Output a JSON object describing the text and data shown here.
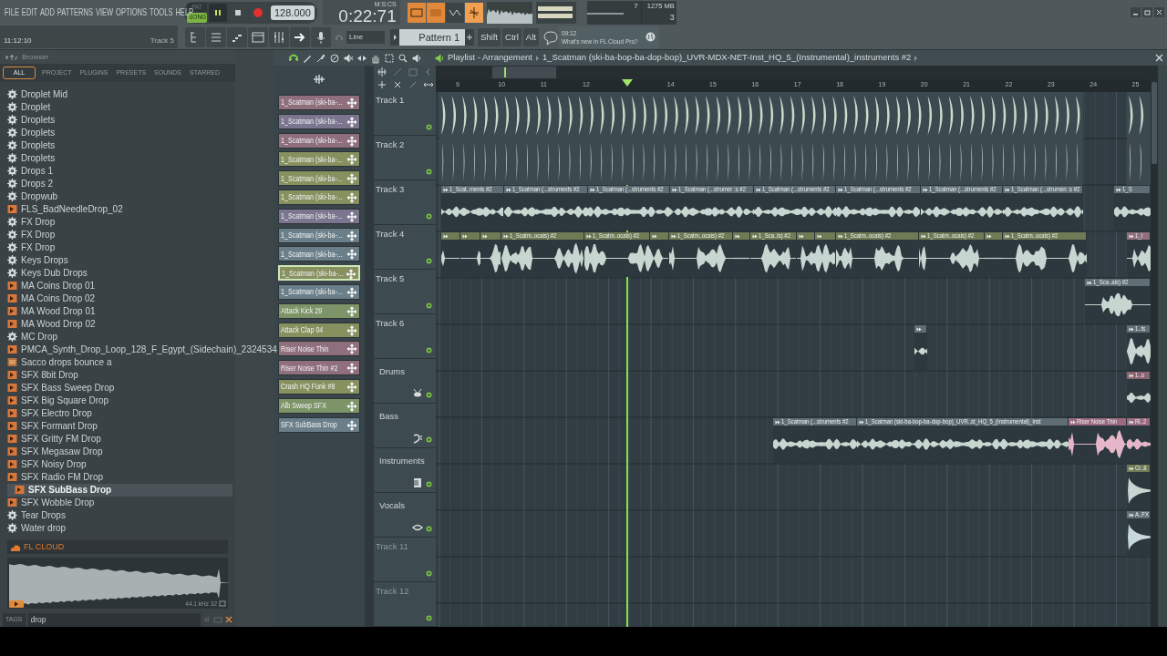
{
  "menu": [
    "FILE",
    "EDIT",
    "ADD",
    "PATTERNS",
    "VIEW",
    "OPTIONS",
    "TOOLS",
    "HELP"
  ],
  "transport": {
    "modes": [
      {
        "label": "PAT",
        "selected": false
      },
      {
        "label": "SONG",
        "selected": true
      }
    ],
    "tempo": "128.000",
    "time_unit": "M:S:CS",
    "time": "0:22:71"
  },
  "hint": {
    "time": "11:12:10",
    "text": "Track 5"
  },
  "snap": "Line",
  "pattern": "Pattern 1",
  "modifier_keys": [
    "Shift",
    "Ctrl",
    "Alt"
  ],
  "news": {
    "time": "09:12",
    "text": "What's new in FL Cloud Pro?"
  },
  "monitor": {
    "cpu": "7",
    "memory": "1275 MB",
    "polyphony": "3"
  },
  "browser": {
    "title": "Browser",
    "tabs": [
      {
        "label": "ALL",
        "selected": true
      },
      {
        "label": "PROJECT",
        "selected": false
      },
      {
        "label": "PLUGINS",
        "selected": false
      },
      {
        "label": "PRESETS",
        "selected": false
      },
      {
        "label": "SOUNDS",
        "selected": false
      },
      {
        "label": "STARRED",
        "selected": false
      }
    ],
    "items": [
      {
        "label": "Droplet Mid",
        "kind": "preset",
        "selected": false
      },
      {
        "label": "Droplet",
        "kind": "preset",
        "selected": false
      },
      {
        "label": "Droplets",
        "kind": "preset",
        "selected": false
      },
      {
        "label": "Droplets",
        "kind": "preset",
        "selected": false
      },
      {
        "label": "Droplets",
        "kind": "preset",
        "selected": false
      },
      {
        "label": "Droplets",
        "kind": "preset",
        "selected": false
      },
      {
        "label": "Drops 1",
        "kind": "preset",
        "selected": false
      },
      {
        "label": "Drops 2",
        "kind": "preset",
        "selected": false
      },
      {
        "label": "Dropwub",
        "kind": "preset",
        "selected": false
      },
      {
        "label": "FLS_BadNeedleDrop_02",
        "kind": "audio",
        "selected": false
      },
      {
        "label": "FX Drop",
        "kind": "preset",
        "selected": false
      },
      {
        "label": "FX Drop",
        "kind": "preset",
        "selected": false
      },
      {
        "label": "FX Drop",
        "kind": "preset",
        "selected": false
      },
      {
        "label": "Keys Drops",
        "kind": "preset",
        "selected": false
      },
      {
        "label": "Keys Dub Drops",
        "kind": "preset",
        "selected": false
      },
      {
        "label": "MA Coins Drop 01",
        "kind": "audio",
        "selected": false
      },
      {
        "label": "MA Coins Drop 02",
        "kind": "audio",
        "selected": false
      },
      {
        "label": "MA Wood Drop 01",
        "kind": "audio",
        "selected": false
      },
      {
        "label": "MA Wood Drop 02",
        "kind": "audio",
        "selected": false
      },
      {
        "label": "MC Drop",
        "kind": "preset",
        "selected": false
      },
      {
        "label": "PMCA_Synth_Drop_Loop_128_F_Egypt_(Sidechain)_2324534",
        "kind": "audio",
        "selected": false
      },
      {
        "label": "Sacco drops bounce a",
        "kind": "project",
        "selected": false
      },
      {
        "label": "SFX 8bit Drop",
        "kind": "audio",
        "selected": false
      },
      {
        "label": "SFX Bass Sweep Drop",
        "kind": "audio",
        "selected": false
      },
      {
        "label": "SFX Big Square Drop",
        "kind": "audio",
        "selected": false
      },
      {
        "label": "SFX Electro Drop",
        "kind": "audio",
        "selected": false
      },
      {
        "label": "SFX Formant Drop",
        "kind": "audio",
        "selected": false
      },
      {
        "label": "SFX Gritty FM Drop",
        "kind": "audio",
        "selected": false
      },
      {
        "label": "SFX Megasaw Drop",
        "kind": "audio",
        "selected": false
      },
      {
        "label": "SFX Noisy Drop",
        "kind": "audio",
        "selected": false
      },
      {
        "label": "SFX Radio FM Drop",
        "kind": "audio",
        "selected": false
      },
      {
        "label": "SFX SubBass Drop",
        "kind": "audio",
        "selected": true
      },
      {
        "label": "SFX Wobble Drop",
        "kind": "audio",
        "selected": false
      },
      {
        "label": "Tear Drops",
        "kind": "preset",
        "selected": false
      },
      {
        "label": "Water drop",
        "kind": "preset",
        "selected": false
      }
    ],
    "cloud": "FL CLOUD",
    "preview_info": "44.1 kHz 32",
    "tags_label": "TAGS",
    "search": "drop"
  },
  "playlist": {
    "title": "Playlist - Arrangement",
    "pattern_name": "1_Scatman (ski-ba-bop-ba-dop-bop)_UVR-MDX-NET-Inst_HQ_5_(Instrumental)_instruments #2",
    "ruler": [
      "9",
      "10",
      "11",
      "12",
      "14",
      "15",
      "16",
      "17",
      "18",
      "19",
      "20",
      "21",
      "22",
      "23",
      "24",
      "25"
    ],
    "picker": [
      {
        "label": "1_Scatman (ski-ba-...",
        "color": "#8f6f7c",
        "selected": false
      },
      {
        "label": "1_Scatman (ski-ba-...",
        "color": "#7b7590",
        "selected": false
      },
      {
        "label": "1_Scatman (ski-ba-...",
        "color": "#8f6f7c",
        "selected": false
      },
      {
        "label": "1_Scatman (ski-ba-...",
        "color": "#87905f",
        "selected": false
      },
      {
        "label": "1_Scatman (ski-ba-...",
        "color": "#87905f",
        "selected": false
      },
      {
        "label": "1_Scatman (ski-ba-...",
        "color": "#87905f",
        "selected": false
      },
      {
        "label": "1_Scatman (ski-ba-...",
        "color": "#7b7590",
        "selected": false
      },
      {
        "label": "1_Scatman (ski-ba-...",
        "color": "#6b7f8a",
        "selected": false
      },
      {
        "label": "1_Scatman (ski-ba-...",
        "color": "#6b7f8a",
        "selected": false
      },
      {
        "label": "1_Scatman (ski-ba-...",
        "color": "#87905f",
        "selected": true
      },
      {
        "label": "1_Scatman (ski-ba-...",
        "color": "#6b7f8a",
        "selected": false
      },
      {
        "label": "Attack Kick 29",
        "color": "#7d9468",
        "selected": false
      },
      {
        "label": "Attack Clap 04",
        "color": "#87905f",
        "selected": false
      },
      {
        "label": "Riser Noise Thin",
        "color": "#8f6f7c",
        "selected": false
      },
      {
        "label": "Riser Noise Thin #2",
        "color": "#8f6f7c",
        "selected": false
      },
      {
        "label": "Crash HQ Funk #8",
        "color": "#87905f",
        "selected": false
      },
      {
        "label": "Alb Sweep SFX",
        "color": "#7d9468",
        "selected": false
      },
      {
        "label": "SFX SubBass Drop",
        "color": "#6b7f8a",
        "selected": false
      }
    ],
    "tracks": [
      {
        "name": "Track 1",
        "kind": "plain",
        "greyed": false
      },
      {
        "name": "Track 2",
        "kind": "plain",
        "greyed": false
      },
      {
        "name": "Track 3",
        "kind": "plain",
        "greyed": false,
        "clips": [
          {
            "label": "1_Scat..ments #2",
            "color": "#5f6e74"
          },
          {
            "label": "1_Scatman (...struments #2",
            "color": "#5f6e74"
          },
          {
            "label": "1_Scatman (...struments #2",
            "color": "#5f6e74"
          },
          {
            "label": "1_Scatman (...strumer :s #2",
            "color": "#5f6e74"
          },
          {
            "label": "1_Scatman (...struments #2",
            "color": "#5f6e74"
          },
          {
            "label": "1_Scatman (...struments #2",
            "color": "#5f6e74"
          },
          {
            "label": "1_Scatman (...struments #2",
            "color": "#5f6e74"
          },
          {
            "label": "1_Scatman (...strumen :s #2",
            "color": "#5f6e74"
          },
          {
            "label": "1_S",
            "color": "#5f6e74"
          }
        ]
      },
      {
        "name": "Track 4",
        "kind": "plain",
        "greyed": false,
        "clips": [
          {
            "label": "1_Scatm..ocals) #2",
            "color": "#6f7b55"
          },
          {
            "label": "1_Scatm..ocals) #2",
            "color": "#6f7b55"
          },
          {
            "label": "1_Scatm..ocals) #2",
            "color": "#6f7b55"
          },
          {
            "label": "1_Sca..ls) #2",
            "color": "#6f7b55"
          },
          {
            "label": "1_Scatm..ocals) #2",
            "color": "#6f7b55"
          },
          {
            "label": "1_Scatm..ocals) #2",
            "color": "#6f7b55"
          },
          {
            "label": "1_Scatm..ocals) #2",
            "color": "#6f7b55"
          },
          {
            "label": "1_I",
            "color": "#8f6f7c"
          }
        ]
      },
      {
        "name": "Track 5",
        "kind": "plain",
        "greyed": false,
        "clips": [
          {
            "label": "1_Sca..als) #2",
            "color": "#5f6e74"
          }
        ]
      },
      {
        "name": "Track 6",
        "kind": "plain",
        "greyed": false,
        "clips": [
          {
            "label": "1..ts",
            "color": "#5f6e74"
          }
        ]
      },
      {
        "name": "Drums",
        "kind": "drums",
        "greyed": false,
        "clips": [
          {
            "label": "1..o",
            "color": "#8a6470"
          }
        ]
      },
      {
        "name": "Bass",
        "kind": "bass",
        "greyed": false,
        "clips": [
          {
            "label": "1_Scatman (...struments #2",
            "color": "#5f6e74"
          },
          {
            "label": "1_Scatman (ski-ba-bop-ba-dop-bop)_UVR..st_HQ_5_(Instrumental)_inst",
            "color": "#5f6e74"
          },
          {
            "label": "Riser Noise Thin",
            "color": "#9b6a80"
          },
          {
            "label": "Ri..2",
            "color": "#9b6a80"
          }
        ]
      },
      {
        "name": "Instruments",
        "kind": "instruments",
        "greyed": false,
        "clips": [
          {
            "label": "Cr..8",
            "color": "#6f7b55"
          }
        ]
      },
      {
        "name": "Vocals",
        "kind": "vocals",
        "greyed": false,
        "clips": [
          {
            "label": "A..FX",
            "color": "#5f6e74"
          }
        ]
      },
      {
        "name": "Track 11",
        "kind": "plain",
        "greyed": true
      },
      {
        "name": "Track 12",
        "kind": "plain",
        "greyed": true
      }
    ]
  }
}
